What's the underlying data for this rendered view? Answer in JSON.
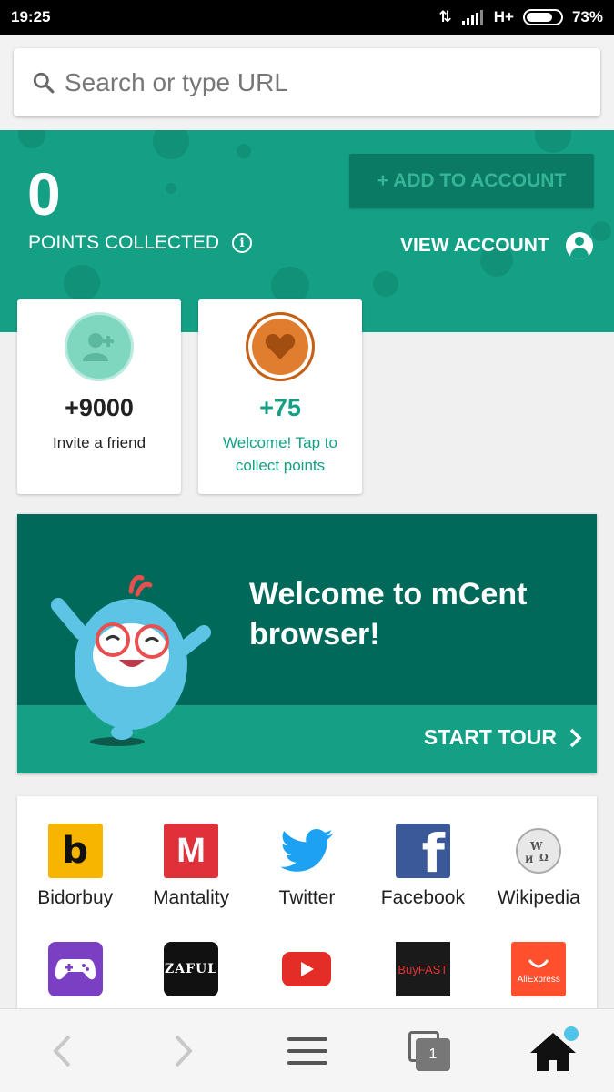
{
  "status": {
    "time": "19:25",
    "network": "H+",
    "battery": "73%"
  },
  "search": {
    "placeholder": "Search or type URL"
  },
  "header": {
    "points": "0",
    "points_label": "POINTS COLLECTED",
    "add_button": "+ ADD TO ACCOUNT",
    "view_account": "VIEW ACCOUNT"
  },
  "cards": [
    {
      "value": "+9000",
      "text": "Invite a friend"
    },
    {
      "value": "+75",
      "text": "Welcome! Tap to collect points"
    }
  ],
  "banner": {
    "title": "Welcome to mCent browser!",
    "cta": "START TOUR"
  },
  "shortcuts": [
    {
      "label": "Bidorbuy",
      "icon": "bidorbuy-icon",
      "color": "#f7b500"
    },
    {
      "label": "Mantality",
      "icon": "mantality-icon",
      "color": "#e0303a"
    },
    {
      "label": "Twitter",
      "icon": "twitter-icon",
      "color": "#1da1f2"
    },
    {
      "label": "Facebook",
      "icon": "facebook-icon",
      "color": "#3b5998"
    },
    {
      "label": "Wikipedia",
      "icon": "wikipedia-icon",
      "color": "#cccccc"
    },
    {
      "label": "",
      "icon": "gamepad-icon",
      "color": "#7b3fc4"
    },
    {
      "label": "ZAFUL",
      "icon": "zaful-icon",
      "color": "#111111"
    },
    {
      "label": "",
      "icon": "youtube-icon",
      "color": "#e52d27"
    },
    {
      "label": "BuyFAST",
      "icon": "buyfast-icon",
      "color": "#1a1a1a"
    },
    {
      "label": "AliExpress",
      "icon": "aliexpress-icon",
      "color": "#ff4f2c"
    }
  ],
  "nav": {
    "tab_count": "1"
  },
  "colors": {
    "brand_green": "#14a085",
    "dark_green": "#00695a"
  }
}
